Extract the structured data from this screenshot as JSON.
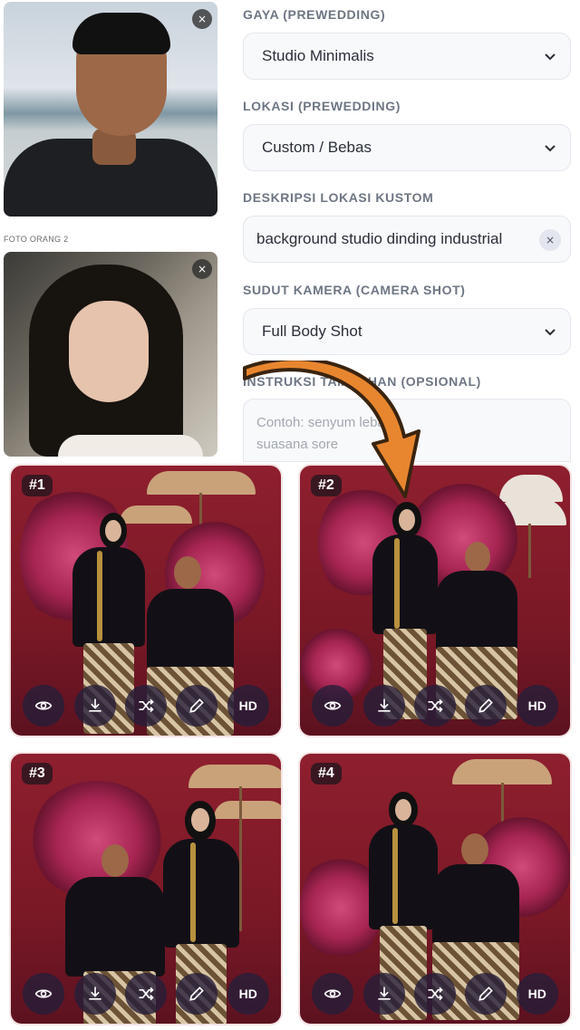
{
  "photos": {
    "person1_remove": "×",
    "person2_label": "FOTO ORANG 2",
    "person2_remove": "×"
  },
  "form": {
    "style": {
      "label": "GAYA (PREWEDDING)",
      "value": "Studio Minimalis"
    },
    "location": {
      "label": "LOKASI (PREWEDDING)",
      "value": "Custom / Bebas"
    },
    "custom_location": {
      "label": "DESKRIPSI LOKASI KUSTOM",
      "value": "background studio dinding industrial",
      "clear": "×"
    },
    "camera": {
      "label": "SUDUT KAMERA (CAMERA SHOT)",
      "value": "Full Body Shot"
    },
    "extra": {
      "label": "INSTRUKSI TAMBAHAN (OPSIONAL)",
      "placeholder_line1": "Contoh: senyum lebar,",
      "placeholder_line2": "suasana sore"
    }
  },
  "results": [
    {
      "number": "#1"
    },
    {
      "number": "#2"
    },
    {
      "number": "#3"
    },
    {
      "number": "#4"
    }
  ],
  "actions": {
    "view_icon": "eye-icon",
    "download_icon": "download-icon",
    "shuffle_icon": "shuffle-icon",
    "edit_icon": "pencil-icon",
    "hd_label": "HD"
  },
  "colors": {
    "accent_arrow": "#e8862f",
    "card_bg": "#8e1f2e",
    "action_bg": "#261e3a"
  }
}
